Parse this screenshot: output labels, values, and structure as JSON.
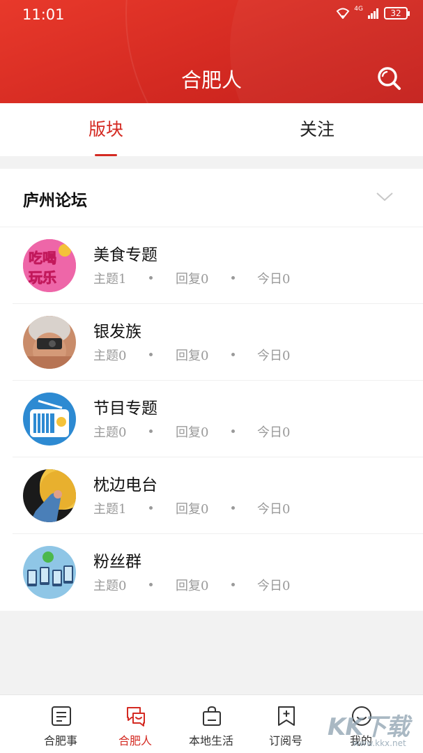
{
  "status_bar": {
    "time": "11:01",
    "network": "4G",
    "battery": "32"
  },
  "header": {
    "title": "合肥人",
    "search_icon": "search-icon"
  },
  "tabs": [
    {
      "label": "版块",
      "active": true
    },
    {
      "label": "关注",
      "active": false
    }
  ],
  "section": {
    "title": "庐州论坛",
    "forums": [
      {
        "name": "美食专题",
        "topics": "主题1",
        "replies": "回复0",
        "today": "今日0",
        "avatar": "food-avatar",
        "avatar_text": [
          "吃喝",
          "玩乐"
        ]
      },
      {
        "name": "银发族",
        "topics": "主题0",
        "replies": "回复0",
        "today": "今日0",
        "avatar": "elderly-avatar"
      },
      {
        "name": "节目专题",
        "topics": "主题0",
        "replies": "回复0",
        "today": "今日0",
        "avatar": "radio-avatar"
      },
      {
        "name": "枕边电台",
        "topics": "主题1",
        "replies": "回复0",
        "today": "今日0",
        "avatar": "pillow-radio-avatar"
      },
      {
        "name": "粉丝群",
        "topics": "主题0",
        "replies": "回复0",
        "today": "今日0",
        "avatar": "fans-avatar"
      }
    ]
  },
  "bottom_nav": [
    {
      "label": "合肥事",
      "icon": "news-icon",
      "active": false
    },
    {
      "label": "合肥人",
      "icon": "chat-icon",
      "active": true
    },
    {
      "label": "本地生活",
      "icon": "shopping-bag-icon",
      "active": false
    },
    {
      "label": "订阅号",
      "icon": "bookmark-add-icon",
      "active": false
    },
    {
      "label": "我的",
      "icon": "smile-icon",
      "active": false
    }
  ],
  "watermark": {
    "main": "KK下载",
    "sub": "www.kkx.net"
  },
  "colors": {
    "accent": "#d42a22",
    "header": "#e0332a",
    "muted_text": "#9a9a9a"
  }
}
